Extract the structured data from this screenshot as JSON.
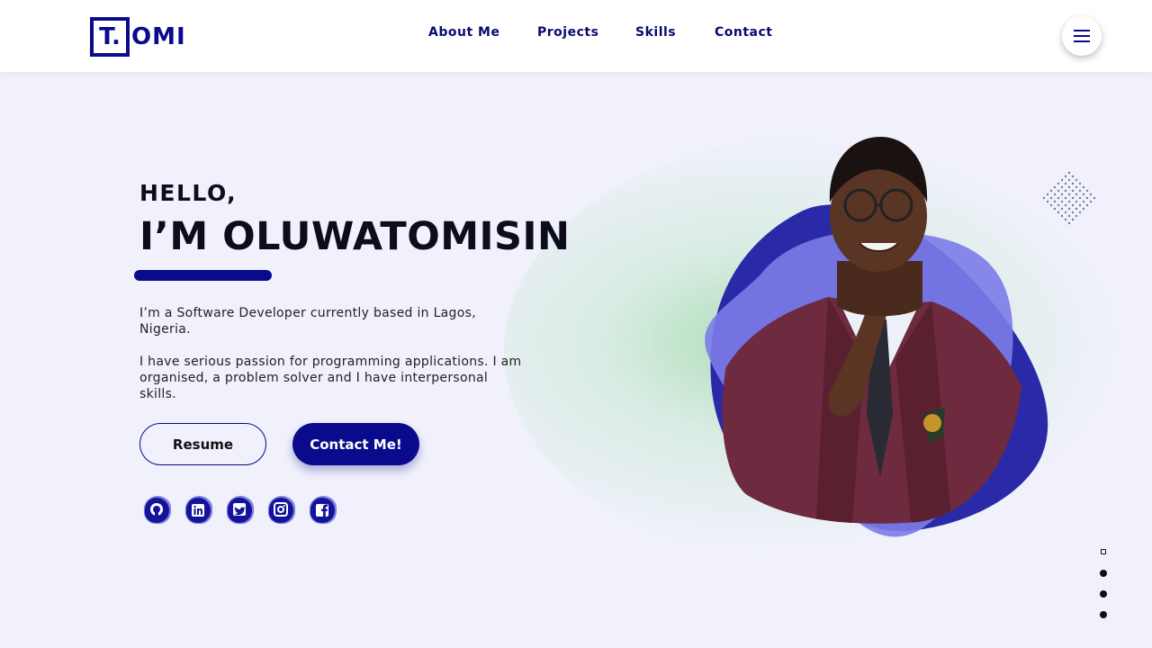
{
  "logo": {
    "box_letter": "T.",
    "rest": "OMI"
  },
  "nav": {
    "items": [
      "About Me",
      "Projects",
      "Skills",
      "Contact"
    ]
  },
  "menu": {
    "icon": "hamburger-icon"
  },
  "hero": {
    "greeting": "HELLO,",
    "name": "I’M OLUWATOMISIN",
    "paragraph1": "I’m a Software Developer currently based in Lagos, Nigeria.",
    "paragraph2": "I have serious passion for programming applications. I am organised, a problem solver and I have interpersonal skills.",
    "resume_label": "Resume",
    "contact_label": "Contact Me!"
  },
  "socials": [
    "github-icon",
    "linkedin-icon",
    "twitter-icon",
    "instagram-icon",
    "facebook-icon"
  ],
  "scroll_indicator": {
    "count": 4,
    "active_index": 0
  },
  "colors": {
    "brand": "#0a0a8c",
    "background": "#f0f1fb",
    "blob_light": "#7b7be8",
    "blob_dark": "#2a2aa8"
  }
}
